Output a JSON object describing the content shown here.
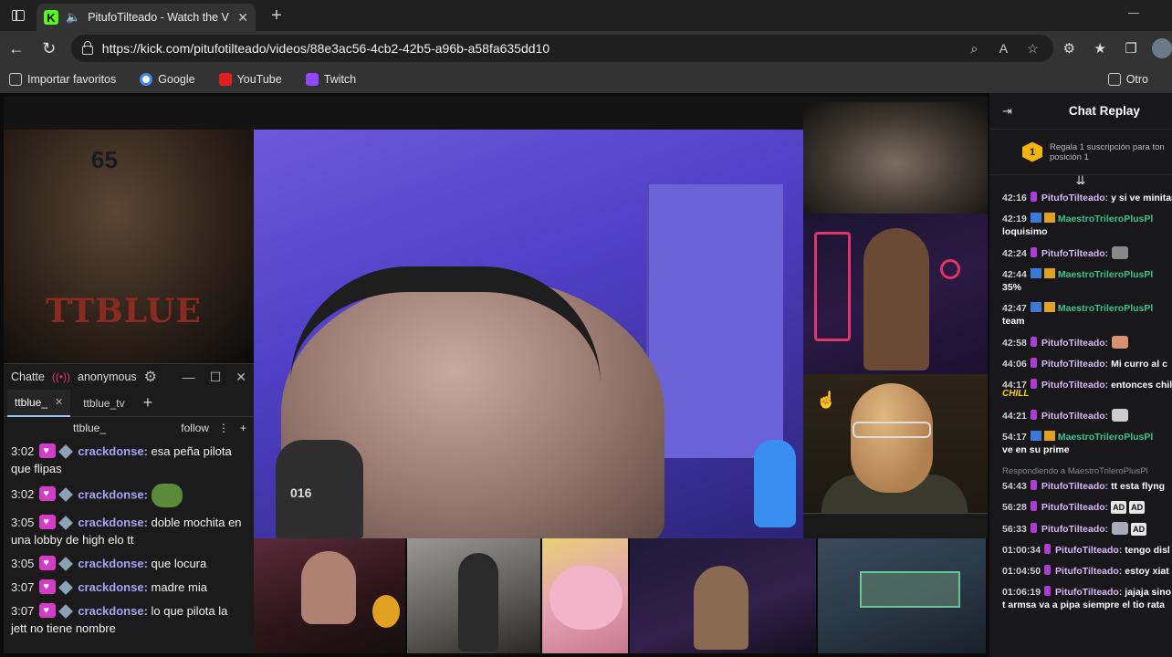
{
  "browser": {
    "tab_title": "PitufoTilteado - Watch the V",
    "url": "https://kick.com/pitufotilteado/videos/88e3ac56-4cb2-42b5-a96b-a58fa635dd10",
    "bookmarks": [
      "Importar favoritos",
      "Google",
      "YouTube",
      "Twitch"
    ],
    "bookmarks_right": "Otro"
  },
  "chatterino": {
    "title": "Chatte",
    "user": "anonymous",
    "tabs": [
      "ttblue_",
      "ttblue_tv"
    ],
    "channel": "ttblue_",
    "follow": "follow",
    "messages": [
      {
        "time": "3:02",
        "user": "crackdonse:",
        "text": "esa peña pilota que flipas"
      },
      {
        "time": "3:02",
        "user": "crackdonse:",
        "text": ""
      },
      {
        "time": "3:05",
        "user": "crackdonse:",
        "text": "doble mochita en una lobby de high elo tt"
      },
      {
        "time": "3:05",
        "user": "crackdonse:",
        "text": "que locura"
      },
      {
        "time": "3:07",
        "user": "crackdonse:",
        "text": "madre mia"
      },
      {
        "time": "3:07",
        "user": "crackdonse:",
        "text": "lo que pilota la jett no tiene nombre"
      }
    ]
  },
  "overlay": {
    "art_number": "65",
    "art_label": "TTBLUE",
    "cat_tag": "016"
  },
  "chat_replay": {
    "title": "Chat Replay",
    "promo_line1": "Regala 1 suscripción para ton",
    "promo_line2": "posición 1",
    "promo_badge": "1",
    "messages": [
      {
        "time": "42:16",
        "user": "PitufoTilteado:",
        "text": "y si ve minitan"
      },
      {
        "time": "42:19",
        "user": "MaestroTrileroPlusPl",
        "text": "loquisimo"
      },
      {
        "time": "42:24",
        "user": "PitufoTilteado:",
        "text": ""
      },
      {
        "time": "42:44",
        "user": "MaestroTrileroPlusPl",
        "text": "35%"
      },
      {
        "time": "42:47",
        "user": "MaestroTrileroPlusPl",
        "text": "team"
      },
      {
        "time": "42:58",
        "user": "PitufoTilteado:",
        "text": ""
      },
      {
        "time": "44:06",
        "user": "PitufoTilteado:",
        "text": "Mi curro al c"
      },
      {
        "time": "44:17",
        "user": "PitufoTilteado:",
        "text": "entonces chil"
      },
      {
        "time": "44:21",
        "user": "PitufoTilteado:",
        "text": ""
      },
      {
        "time": "54:17",
        "user": "MaestroTrileroPlusPl",
        "text": "ve en su prime"
      },
      {
        "reply": "Respondiendo a MaestroTrileroPlusPl"
      },
      {
        "time": "54:43",
        "user": "PitufoTilteado:",
        "text": "tt esta flyng"
      },
      {
        "time": "56:28",
        "user": "PitufoTilteado:",
        "text": ""
      },
      {
        "time": "56:33",
        "user": "PitufoTilteado:",
        "text": ""
      },
      {
        "time": "01:00:34",
        "user": "PitufoTilteado:",
        "text": "tengo disl"
      },
      {
        "time": "01:04:50",
        "user": "PitufoTilteado:",
        "text": "estoy xiat"
      },
      {
        "time": "01:06:19",
        "user": "PitufoTilteado:",
        "text": "jajaja sino t armsa va a pipa siempre el tio rata"
      }
    ],
    "chill_tag": "CHILL",
    "ad_emote": "AD"
  }
}
